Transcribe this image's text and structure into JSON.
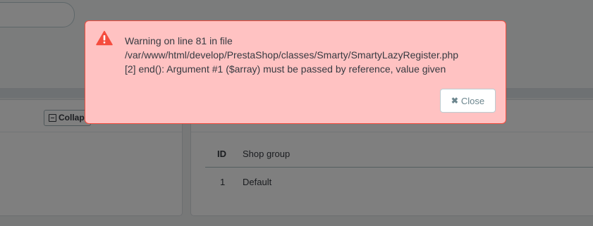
{
  "background": {
    "collapse_button_label": "Collap",
    "table": {
      "headers": [
        "ID",
        "Shop group"
      ],
      "rows": [
        [
          "1",
          "Default"
        ]
      ]
    }
  },
  "alert": {
    "icon": "warning-triangle-icon",
    "lines": [
      "Warning on line 81 in file",
      "/var/www/html/develop/PrestaShop/classes/Smarty/SmartyLazyRegister.php",
      "[2] end(): Argument #1 ($array) must be passed by reference, value given"
    ],
    "close_label": "Close",
    "close_icon": "close-x-icon"
  },
  "colors": {
    "alert_bg": "#ffc2c2",
    "alert_border": "#f54c3e",
    "icon_red": "#f54c3e"
  }
}
